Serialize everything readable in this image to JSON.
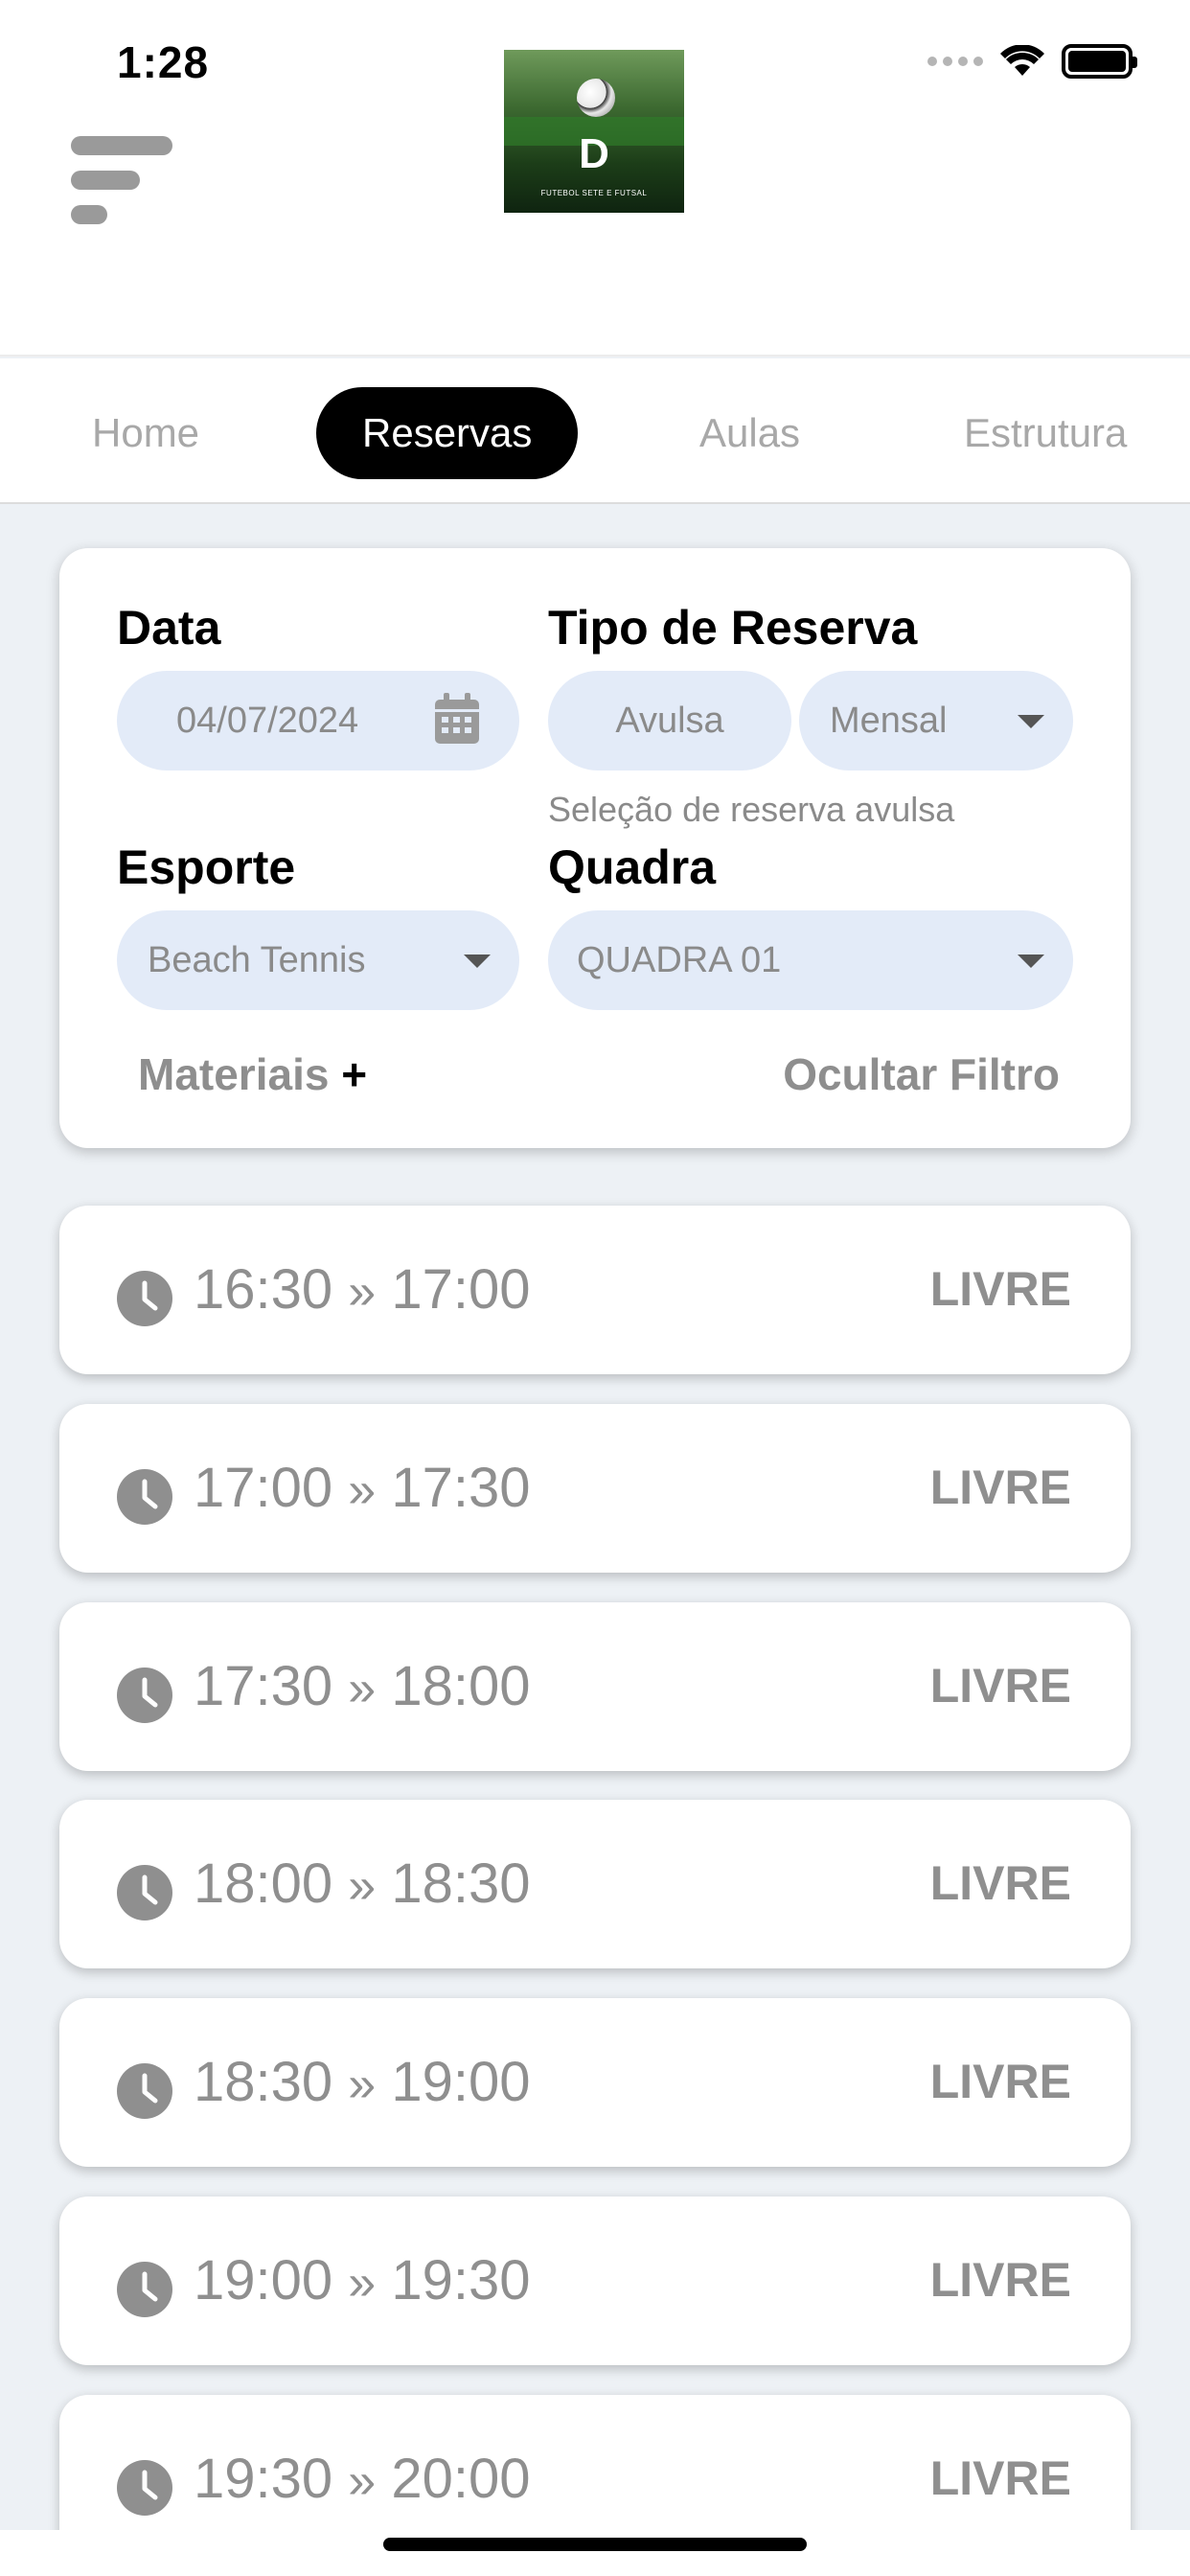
{
  "status_bar": {
    "time": "1:28"
  },
  "header": {
    "logo_alt": "Logo",
    "logo_tagline": "FUTEBOL SETE E FUTSAL"
  },
  "tabs": [
    {
      "label": "Home",
      "active": false
    },
    {
      "label": "Reservas",
      "active": true
    },
    {
      "label": "Aulas",
      "active": false
    },
    {
      "label": "Estrutura",
      "active": false
    }
  ],
  "filter": {
    "date_label": "Data",
    "date_value": "04/07/2024",
    "reservation_type_label": "Tipo de Reserva",
    "reservation_type_option_1": "Avulsa",
    "reservation_type_option_2": "Mensal",
    "reservation_hint": "Seleção de reserva avulsa",
    "sport_label": "Esporte",
    "sport_value": "Beach Tennis",
    "court_label": "Quadra",
    "court_value": "QUADRA 01",
    "materials_link": "Materiais",
    "materials_plus": "+",
    "hide_filter_link": "Ocultar Filtro"
  },
  "slots": [
    {
      "start": "16:30",
      "end": "17:00",
      "status": "LIVRE"
    },
    {
      "start": "17:00",
      "end": "17:30",
      "status": "LIVRE"
    },
    {
      "start": "17:30",
      "end": "18:00",
      "status": "LIVRE"
    },
    {
      "start": "18:00",
      "end": "18:30",
      "status": "LIVRE"
    },
    {
      "start": "18:30",
      "end": "19:00",
      "status": "LIVRE"
    },
    {
      "start": "19:00",
      "end": "19:30",
      "status": "LIVRE"
    },
    {
      "start": "19:30",
      "end": "20:00",
      "status": "LIVRE"
    }
  ],
  "separator": "»",
  "colors": {
    "accent": "#000000",
    "pill_bg": "#e3ebf8",
    "muted_text": "#8f8f8f",
    "background": "#edf1f5"
  }
}
